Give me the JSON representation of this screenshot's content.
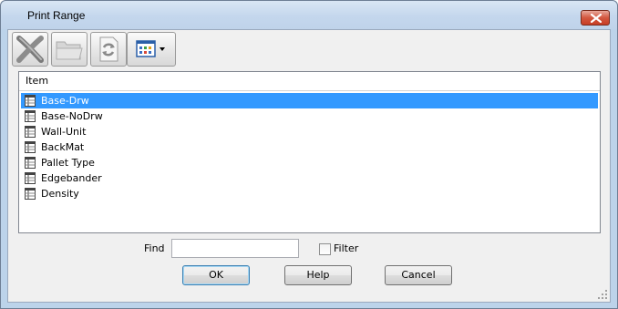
{
  "window": {
    "title": "Print Range"
  },
  "toolbar": {
    "delete_icon": "delete-x-icon",
    "open_icon": "folder-icon",
    "refresh_icon": "refresh-icon",
    "view_icon": "grid-view-icon"
  },
  "list": {
    "header": "Item",
    "items": [
      {
        "label": "Base-Drw",
        "selected": true
      },
      {
        "label": "Base-NoDrw"
      },
      {
        "label": "Wall-Unit"
      },
      {
        "label": "BackMat"
      },
      {
        "label": "Pallet Type"
      },
      {
        "label": "Edgebander"
      },
      {
        "label": "Density"
      }
    ],
    "selection_color": "#3399ff"
  },
  "find": {
    "label": "Find",
    "value": "",
    "placeholder": ""
  },
  "filter": {
    "label": "Filter",
    "checked": false
  },
  "buttons": {
    "ok": "OK",
    "help": "Help",
    "cancel": "Cancel"
  }
}
